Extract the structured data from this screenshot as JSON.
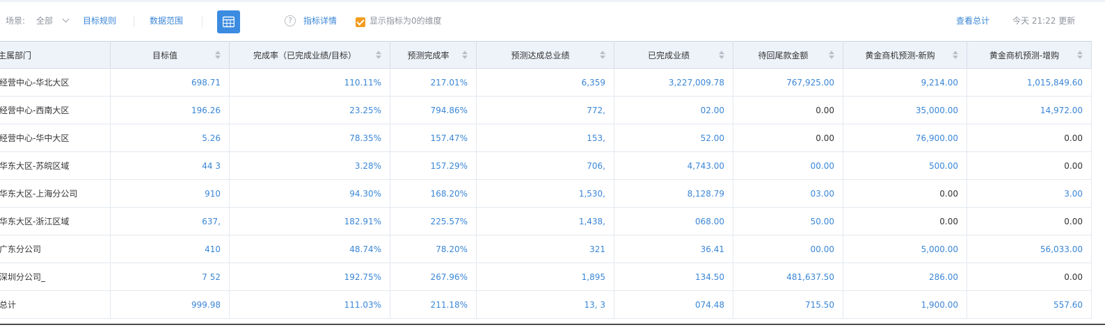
{
  "toolbar": {
    "scene_label": "场景:",
    "scene_value": "全部",
    "target_rules": "目标规则",
    "data_range": "数据范围",
    "metric_details": "指标详情",
    "show_zero_label": "显示指标为0的维度",
    "view_total": "查看总计",
    "updated_text": "今天 21:22 更新"
  },
  "table": {
    "headers": [
      "主属部门",
      "目标值",
      "完成率（已完成业绩/目标）",
      "预测完成率",
      "预测达成总业绩",
      "已完成业绩",
      "待回尾款金额",
      "黄金商机预测-新购",
      "黄金商机预测-增购"
    ],
    "rows": [
      [
        "经营中心-华北大区",
        "698.71",
        "110.11%",
        "217.01%",
        "6,359",
        "3,227,009.78",
        "767,925.00",
        "9,214.00",
        "1,015,849.60"
      ],
      [
        "经营中心-西南大区",
        "196.26",
        "23.25%",
        "794.86%",
        "772,",
        "02.00",
        "0.00",
        "35,000.00",
        "14,972.00"
      ],
      [
        "经营中心-华中大区",
        "5.26",
        "78.35%",
        "157.47%",
        "153,",
        "52.00",
        "0.00",
        "76,900.00",
        "0.00"
      ],
      [
        "华东大区-苏皖区域",
        "44 3",
        "3.28%",
        "157.29%",
        "706,",
        "4,743.00",
        "00.00",
        "500.00",
        "0.00"
      ],
      [
        "华东大区-上海分公司",
        "910",
        "94.30%",
        "168.20%",
        "1,530,",
        "8,128.79",
        "03.00",
        "0.00",
        "3.00"
      ],
      [
        "华东大区-浙江区域",
        "637,",
        "182.91%",
        "225.57%",
        "1,438,",
        "068.00",
        "50.00",
        "0.00",
        "0.00"
      ],
      [
        "广东分公司",
        "410",
        "48.74%",
        "78.20%",
        "321",
        "36.41",
        "00.00",
        "5,000.00",
        "56,033.00"
      ],
      [
        "深圳分公司_",
        "7 52",
        "192.75%",
        "267.96%",
        "1,895",
        "134.50",
        "481,637.50",
        "286.00",
        "0.00"
      ],
      [
        "总计",
        "999.98",
        "111.03%",
        "211.18%",
        "13, 3",
        "074.48",
        "715.50",
        "1,900.00",
        "557.60"
      ]
    ]
  },
  "colors": {
    "accent": "#3a86d6",
    "checkbox": "#f39c1f",
    "header_bg": "#eef3fa"
  },
  "icons": {
    "table_view": "table-grid-icon",
    "help": "question-circle-icon",
    "checkbox": "checkbox-checked-icon",
    "dropdown": "chevron-down-icon",
    "sort": "sort-arrows-icon"
  }
}
